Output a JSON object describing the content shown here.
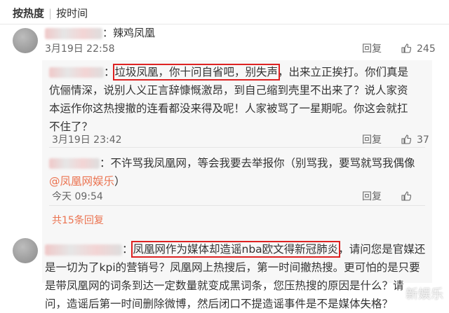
{
  "sort": {
    "hot": "按热度",
    "sep": "|",
    "time": "按时间"
  },
  "comment1": {
    "name_suffix": "：辣鸡凤凰",
    "time": "3月19日 22:58",
    "reply_label": "回复",
    "likes": "245"
  },
  "reply1": {
    "highlight": "垃圾凤凰，你十问自省吧，别失声",
    "line1_rest": "，出来立正挨打。你们真是",
    "line2": "伉俪情深，说别人义正言辞慷慨激昂，到自己缩到壳里不出来了？说人家资",
    "line3": "本运作你这热搜撤的连看都没来得及呢！人家被骂了一星期呢。你这会就扛",
    "line4": "不住了？",
    "time": "3月19日 23:42",
    "reply_label": "回复",
    "likes": "37"
  },
  "reply2": {
    "line1": "：不许骂我凤凰网，等会我要去举报你（别骂我，要骂就骂我偶像",
    "mention": "@凤凰网娱乐",
    "mention_close": "）",
    "time": "今天 09:54",
    "reply_label": "回复"
  },
  "more_link": "共15条回复",
  "comment2": {
    "highlight": "凤凰网作为媒体却造谣nba欧文得新冠肺炎",
    "line1_rest": "，请问您是官媒还",
    "line2": "是一切为了kpi的营销号？凤凰网上热搜后，第一时间撤热搜。更可怕的是只要",
    "line3": "是带凤凰网的词条到达一定数量就变成黑词条，您压热搜的原因是什么？请",
    "line4": "问，造谣后第一时间删除微博，然后闭口不提造谣事件是不是媒体失格？"
  },
  "watermark": "新娱乐"
}
